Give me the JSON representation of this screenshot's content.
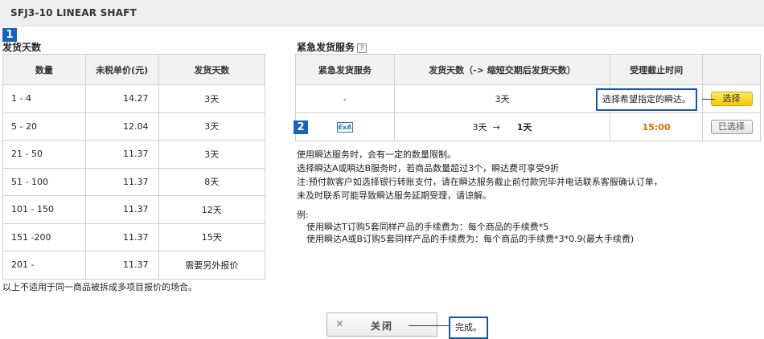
{
  "header": {
    "title": "SFJ3-10   LINEAR SHAFT"
  },
  "steps": {
    "one": "1",
    "two": "2"
  },
  "shipping": {
    "title": "发货天数",
    "columns": [
      "数量",
      "未税单价(元)",
      "发货天数"
    ],
    "rows": [
      {
        "qty": "1 - 4",
        "price": "14.27",
        "days": "3天"
      },
      {
        "qty": "5 - 20",
        "price": "12.04",
        "days": "3天"
      },
      {
        "qty": "21 - 50",
        "price": "11.37",
        "days": "3天"
      },
      {
        "qty": "51 - 100",
        "price": "11.37",
        "days": "8天"
      },
      {
        "qty": "101 - 150",
        "price": "11.37",
        "days": "12天"
      },
      {
        "qty": "151 -200",
        "price": "11.37",
        "days": "15天"
      },
      {
        "qty": "201 -",
        "price": "11.37",
        "days": "需要另外报价"
      }
    ],
    "footnote": "以上不适用于同一商品被拆成多项目报价的场合。"
  },
  "express": {
    "title": "紧急发货服务",
    "help_icon": "?",
    "columns": [
      "紧急发货服务",
      "发货天数（-> 缩短交期后发货天数）",
      "受理截止时间",
      ""
    ],
    "row1": {
      "service": "-",
      "days": "3天",
      "callout": "选择希望指定的瞬达。",
      "button": "选择"
    },
    "row2": {
      "service_icon_label": "ExA",
      "days_from": "3天",
      "arrow": "→",
      "days_to": "1天",
      "deadline": "15:00",
      "button": "已选择"
    },
    "notes": [
      "使用瞬达服务时，会有一定的数量限制。",
      "选择瞬达A或瞬达B服务时，若商品数量超过3个，瞬达费可享受9折",
      "注:预付款客户如选择银行转账支付，请在瞬达服务截止前付款完毕并电话联系客服确认订单，",
      "未及时联系可能导致瞬达服务延期受理，请谅解。"
    ],
    "example_title": "例:",
    "examples": [
      "使用瞬达T订购5套同样产品的手续费为：每个商品的手续费*5",
      "使用瞬达A或B订购5套同样产品的手续费为：每个商品的手续费*3*0.9(最大手续费)"
    ]
  },
  "footer": {
    "close_icon": "×",
    "close_label": "关闭",
    "done_callout": "完成。"
  },
  "colors": {
    "accent_blue": "#1554a8",
    "select_yellow": "#f7c600",
    "deadline_orange": "#e06a00"
  }
}
